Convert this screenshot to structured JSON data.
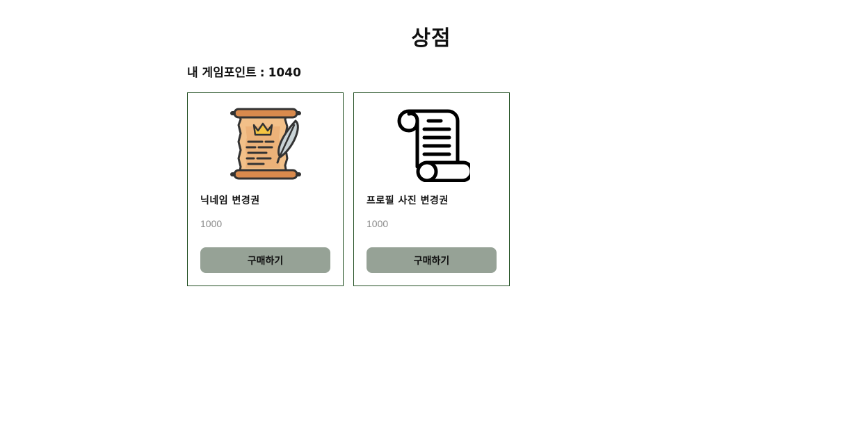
{
  "page": {
    "title": "상점"
  },
  "points": {
    "label": "내 게임포인트",
    "separator": ":",
    "value": "1040"
  },
  "items": [
    {
      "name": "닉네임 변경권",
      "price": "1000",
      "buy_label": "구매하기",
      "icon": "royal-scroll-quill-icon"
    },
    {
      "name": "프로필 사진 변경권",
      "price": "1000",
      "buy_label": "구매하기",
      "icon": "scroll-icon"
    }
  ],
  "colors": {
    "card_border": "#1f4d1f",
    "button_bg": "#96a296",
    "price_text": "#8a8a8a"
  }
}
